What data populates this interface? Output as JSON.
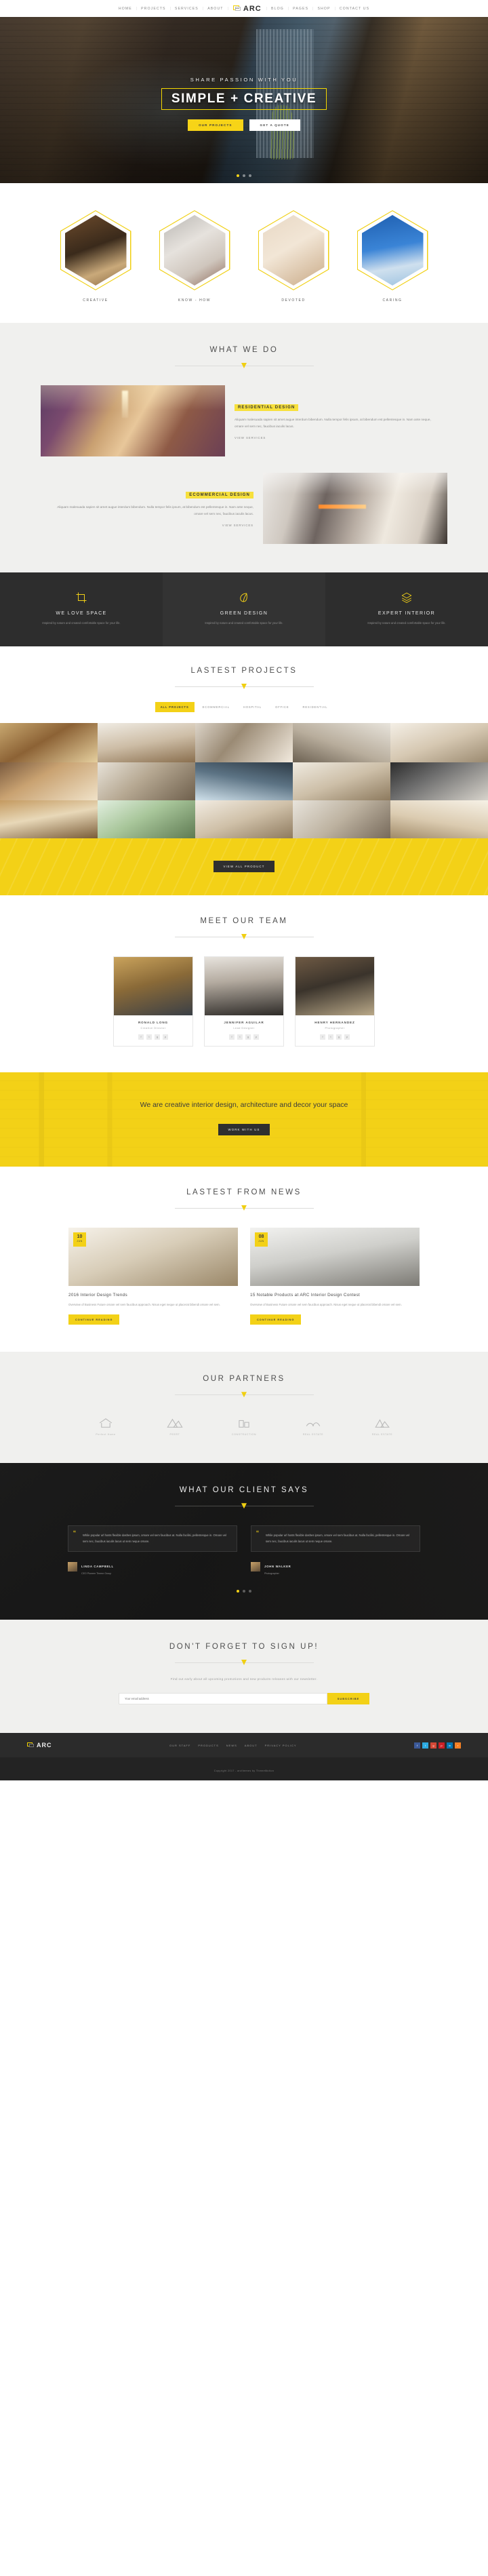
{
  "header": {
    "brand": "ARC",
    "nav_left": [
      "HOME",
      "PROJECTS",
      "SERVICES",
      "ABOUT"
    ],
    "nav_right": [
      "BLOG",
      "PAGES",
      "SHOP",
      "CONTACT US"
    ]
  },
  "hero": {
    "subtitle": "SHARE PASSION WITH YOU",
    "title": "SIMPLE + CREATIVE",
    "btn_primary": "OUR PROJECTS",
    "btn_secondary": "GET A QUOTE"
  },
  "features": [
    {
      "label": "CREATIVE",
      "icon": "hexagon-image-creative"
    },
    {
      "label": "KNOW - HOW",
      "icon": "hexagon-image-knowhow"
    },
    {
      "label": "DEVOTED",
      "icon": "hexagon-image-devoted"
    },
    {
      "label": "CARING",
      "icon": "hexagon-image-caring"
    }
  ],
  "what_we_do": {
    "title": "WHAT WE DO",
    "items": [
      {
        "tag": "RESIDENTIAL DESIGN",
        "body": "Aliquam malesuada sapien sit amet augue interdum bibendum. Nulla tempor felis ipsum, at bibendum est pellentesque in. Nam ante neque, ornare vel sem nec, faucibus iaculis lacus.",
        "link": "VIEW SERVICES"
      },
      {
        "tag": "ECOMMERCIAL DESIGN",
        "body": "Aliquam malesuada sapien sit amet augue interdum bibendum. Nulla tempor felis ipsum, at bibendum est pellentesque in. Nam ante neque, ornare vel sem nec, faucibus iaculis lacus.",
        "link": "VIEW SERVICES"
      }
    ]
  },
  "services": [
    {
      "icon": "crop-icon",
      "title": "WE LOVE SPACE",
      "sub": "Inspired by nature and created comfortable space for your life."
    },
    {
      "icon": "leaf-icon",
      "title": "GREEN DESIGN",
      "sub": "Inspired by nature and created comfortable space for your life."
    },
    {
      "icon": "layers-icon",
      "title": "EXPERT INTERIOR",
      "sub": "Inspired by nature and created comfortable space for your life."
    }
  ],
  "projects": {
    "title": "LASTEST PROJECTS",
    "filters": [
      "ALL PROJECTS",
      "ECOMMERCIAL",
      "HOSPITAL",
      "OFFICE",
      "RESIDENTIAL"
    ],
    "active_filter": "ALL PROJECTS",
    "cta": "VIEW ALL PRODUCT",
    "tile_count": 15
  },
  "team": {
    "title": "MEET OUR TEAM",
    "members": [
      {
        "name": "RONALD LONG",
        "role": "Creative Director",
        "socials": [
          "f",
          "t",
          "g",
          "p"
        ]
      },
      {
        "name": "JENNIFER AGUILAR",
        "role": "Lead Designer",
        "socials": [
          "f",
          "t",
          "g",
          "p"
        ]
      },
      {
        "name": "HENRY HERNANDEZ",
        "role": "Photographer",
        "socials": [
          "f",
          "t",
          "g",
          "p"
        ]
      }
    ]
  },
  "banner": {
    "text": "We are creative interior design, architecture and decor your space",
    "button": "WORK WITH US"
  },
  "news": {
    "title": "LASTEST FROM NEWS",
    "posts": [
      {
        "day": "10",
        "month": "JUN",
        "title": "2016 Interior Design Trends",
        "body": "Overview of Business Future ornare vel sem faucibus approach. Nisus eget neque ut placerat bibendi ornare vel sem.",
        "button": "CONTINUE READING"
      },
      {
        "day": "08",
        "month": "JUN",
        "title": "15 Notable Products at ARC Interior Design Contest",
        "body": "Overview of Business Future ornare vel sem faucibus approach. Nisus eget neque ut placerat bibendi ornare vel sem.",
        "button": "CONTINUE READING"
      }
    ]
  },
  "partners": {
    "title": "OUR PARTNERS",
    "logos": [
      {
        "name": "Perfect Home",
        "icon": "house-icon"
      },
      {
        "name": "PEERT",
        "icon": "peert-icon"
      },
      {
        "name": "CONSTRUCTION",
        "icon": "construction-icon"
      },
      {
        "name": "REAL ESTATE",
        "icon": "real-estate-icon"
      },
      {
        "name": "REAL ESTATE",
        "icon": "mountain-icon"
      }
    ]
  },
  "testimonials": {
    "title": "WHAT OUR CLIENT SAYS",
    "items": [
      {
        "text": "While popular url hosts flexible dashes ipsum, ornare vel sem faucibus at. Nulla facilisi, pellentesque in. Ornare vel sem nec, faucibus iaculis lacus ut sem neque ornare.",
        "name": "LINDA CAMPBELL",
        "role": "CEO Pioneer Theme Group"
      },
      {
        "text": "While popular url hosts flexible dashes ipsum, ornare vel sem faucibus at. Nulla facilisi, pellentesque in. Ornare vel sem nec, faucibus iaculis lacus ut sem neque ornare.",
        "name": "JOHN WALKER",
        "role": "Photographer"
      }
    ]
  },
  "signup": {
    "title": "DON'T FORGET TO SIGN UP!",
    "sub": "Find out early about all upcoming promotions and new products releases with our newsletter.",
    "placeholder": "Your email address",
    "button": "SUBSCRIBE"
  },
  "footer": {
    "brand": "ARC",
    "nav": [
      "OUR STAFF",
      "PRODUCTS",
      "NEWS",
      "ABOUT",
      "PRIVACY POLICY"
    ],
    "socials": [
      "f",
      "t",
      "g",
      "p",
      "in",
      "r"
    ],
    "copyright": "Copyright 2017 - arcthemes by ThemeMotion"
  }
}
